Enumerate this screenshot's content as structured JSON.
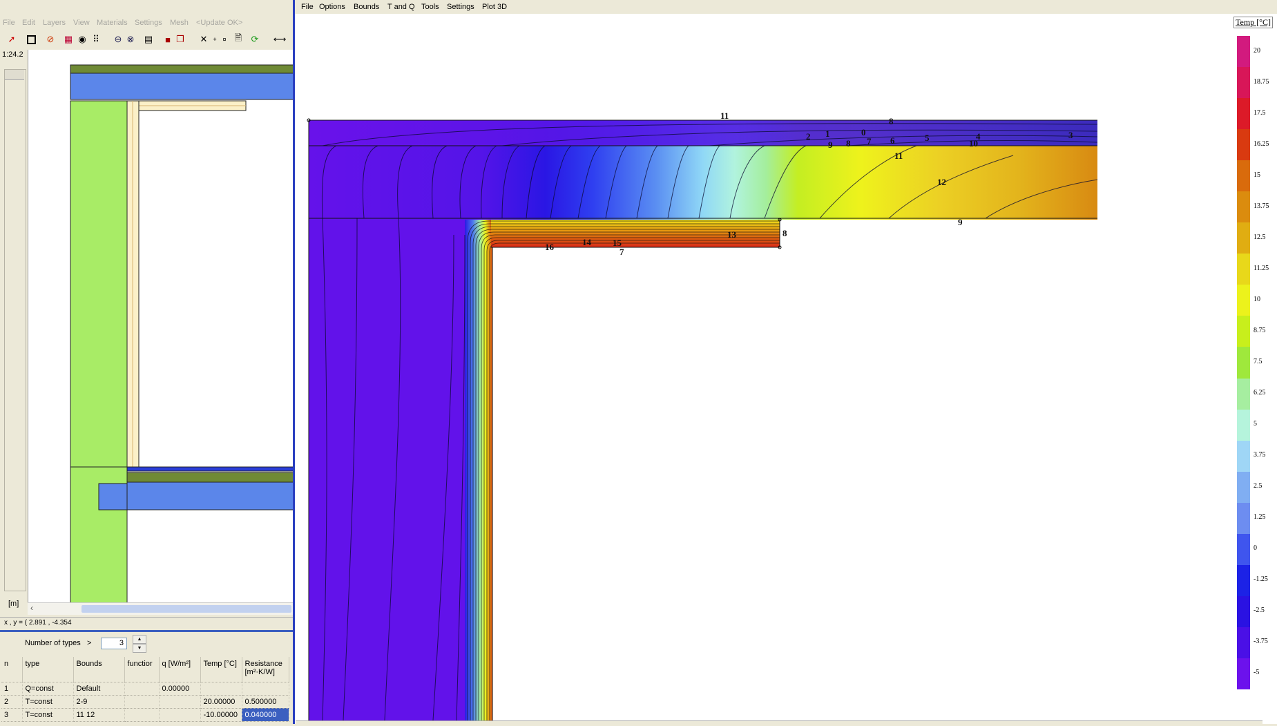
{
  "left_menu": [
    "File",
    "Edit",
    "Layers",
    "View",
    "Materials",
    "Settings",
    "Mesh",
    "<Update OK>"
  ],
  "scale_label": "1:24.2",
  "unit_label": "[m]",
  "coord_text": "x , y = ( 2.891 , -4.354",
  "bc_panel": {
    "num_types_label": "Number of types",
    "num_types_arrow": ">",
    "num_types_value": "3",
    "columns": [
      "n",
      "type",
      "Bounds",
      "functior",
      "q [W/m²]",
      "Temp [°C]",
      "Resistance [m²·K/W]"
    ],
    "rows": [
      {
        "n": "1",
        "type": "Q=const",
        "bounds": "Default",
        "func": "",
        "q": "0.00000",
        "temp": "",
        "res": ""
      },
      {
        "n": "2",
        "type": "T=const",
        "bounds": "2-9",
        "func": "",
        "q": "",
        "temp": "20.00000",
        "res": "0.500000"
      },
      {
        "n": "3",
        "type": "T=const",
        "bounds": "11 12",
        "func": "",
        "q": "",
        "temp": "-10.00000",
        "res": "0.040000"
      }
    ]
  },
  "right_menu": [
    "File",
    "Options",
    "Bounds",
    "T and Q",
    "Tools",
    "Settings",
    "Plot 3D"
  ],
  "legend": {
    "title": "Temp [°C]",
    "values": [
      "20",
      "18.75",
      "17.5",
      "16.25",
      "15",
      "13.75",
      "12.5",
      "11.25",
      "10",
      "8.75",
      "7.5",
      "6.25",
      "5",
      "3.75",
      "2.5",
      "1.25",
      "0",
      "-1.25",
      "-2.5",
      "-3.75",
      "-5"
    ],
    "colors": [
      "#d21a7e",
      "#d81658",
      "#dc1a28",
      "#d93a10",
      "#d96b0c",
      "#db8c0e",
      "#e0ad12",
      "#e8d81a",
      "#ecf21c",
      "#c8ef1c",
      "#9fe83c",
      "#a6eea0",
      "#b5f4dc",
      "#9fd6f6",
      "#80aef2",
      "#6d8df0",
      "#3f55ee",
      "#1c22e6",
      "#2a12e2",
      "#4a10e6",
      "#6c12ec"
    ]
  },
  "contour_labels": [
    "11",
    "8",
    "2",
    "1",
    "0",
    "9",
    "8",
    "7",
    "6",
    "5",
    "4",
    "3",
    "10",
    "11",
    "12",
    "9",
    "8",
    "13",
    "16",
    "14",
    "15",
    "7"
  ]
}
